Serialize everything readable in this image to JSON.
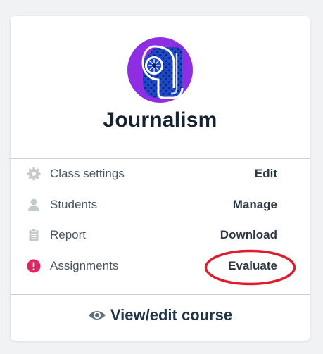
{
  "course": {
    "title": "Journalism",
    "logo_icon": "journalism-course-logo"
  },
  "menu": [
    {
      "key": "class-settings",
      "icon": "gear-icon",
      "label": "Class settings",
      "action": "Edit"
    },
    {
      "key": "students",
      "icon": "person-icon",
      "label": "Students",
      "action": "Manage"
    },
    {
      "key": "report",
      "icon": "clipboard-icon",
      "label": "Report",
      "action": "Download"
    },
    {
      "key": "assignments",
      "icon": "alert-icon",
      "label": "Assignments",
      "action": "Evaluate"
    }
  ],
  "footer": {
    "icon": "eye-icon",
    "label": "View/edit course"
  },
  "colors": {
    "alert": "#e0245e",
    "highlight_circle": "#e01b2a",
    "logo_purple": "#8e2de2",
    "logo_blue": "#1d49c9"
  }
}
